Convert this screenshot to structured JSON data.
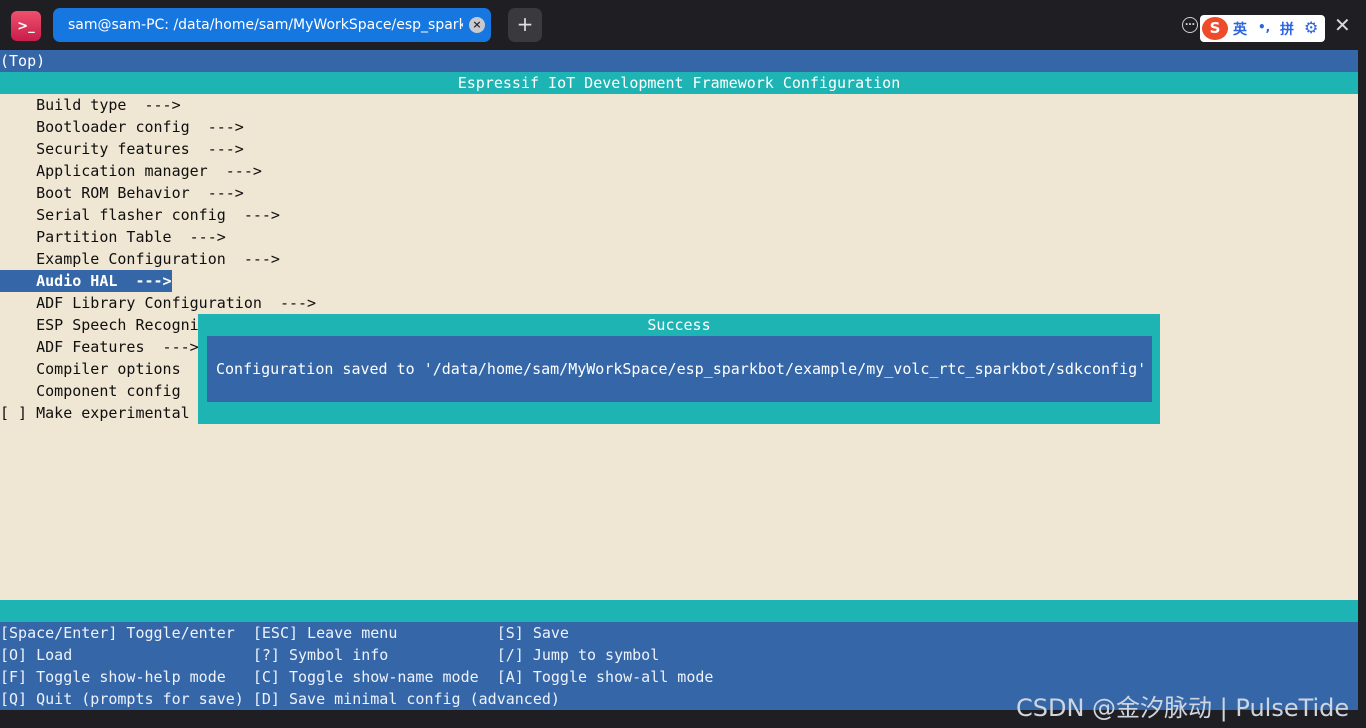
{
  "window": {
    "tab_title": "sam@sam-PC: /data/home/sam/MyWorkSpace/esp_sparkbo…",
    "tab_close": "×",
    "new_tab": "+",
    "more": "…",
    "close": "✕"
  },
  "ime": {
    "logo": "S",
    "lang": "英",
    "punct": "•,",
    "mode": "拼",
    "settings": "⚙"
  },
  "terminal": {
    "breadcrumb": "(Top)",
    "header": "Espressif IoT Development Framework Configuration",
    "menu_items": [
      "    Build type  --->",
      "    Bootloader config  --->",
      "    Security features  --->",
      "    Application manager  --->",
      "    Boot ROM Behavior  --->",
      "    Serial flasher config  --->",
      "    Partition Table  --->",
      "    Example Configuration  --->",
      "    Audio HAL  --->",
      "    ADF Library Configuration  --->",
      "    ESP Speech Recogni",
      "    ADF Features  --->",
      "    Compiler options",
      "    Component config",
      "[ ] Make experimental"
    ],
    "selected_index": 8,
    "footer_lines": [
      "[Space/Enter] Toggle/enter  [ESC] Leave menu           [S] Save",
      "[O] Load                    [?] Symbol info            [/] Jump to symbol",
      "[F] Toggle show-help mode   [C] Toggle show-name mode  [A] Toggle show-all mode",
      "[Q] Quit (prompts for save) [D] Save minimal config (advanced)"
    ]
  },
  "dialog": {
    "title": "Success",
    "message": "Configuration saved to '/data/home/sam/MyWorkSpace/esp_sparkbot/example/my_volc_rtc_sparkbot/sdkconfig'"
  },
  "watermark": "CSDN @金汐脉动 | PulseTide"
}
